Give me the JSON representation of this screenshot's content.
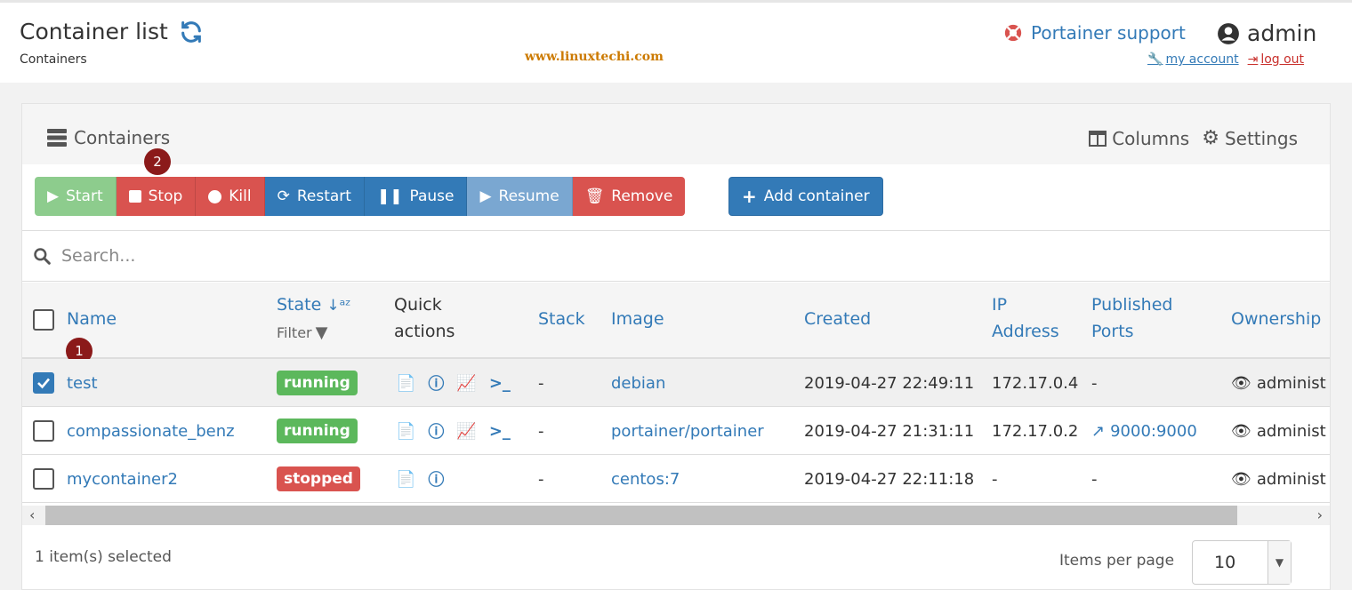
{
  "header": {
    "title": "Container list",
    "breadcrumb": "Containers",
    "watermark": "www.linuxtechi.com",
    "support_link": "Portainer support",
    "user": "admin",
    "my_account": "my account",
    "log_out": "log out"
  },
  "panel": {
    "title": "Containers",
    "columns_label": "Columns",
    "settings_label": "Settings"
  },
  "actions": {
    "start": "Start",
    "stop": "Stop",
    "kill": "Kill",
    "restart": "Restart",
    "pause": "Pause",
    "resume": "Resume",
    "remove": "Remove",
    "add_container": "Add container"
  },
  "markers": {
    "one": "1",
    "two": "2"
  },
  "search": {
    "placeholder": "Search..."
  },
  "columns": {
    "name": "Name",
    "state": "State",
    "filter": "Filter",
    "quick_actions_1": "Quick",
    "quick_actions_2": "actions",
    "stack": "Stack",
    "image": "Image",
    "created": "Created",
    "ip_1": "IP",
    "ip_2": "Address",
    "ports_1": "Published",
    "ports_2": "Ports",
    "ownership": "Ownership"
  },
  "rows": [
    {
      "name": "test",
      "state": "running",
      "stack": "-",
      "image": "debian",
      "created": "2019-04-27 22:49:11",
      "ip": "172.17.0.4",
      "ports": "-",
      "ownership": "administ",
      "selected": true
    },
    {
      "name": "compassionate_benz",
      "state": "running",
      "stack": "-",
      "image": "portainer/portainer",
      "created": "2019-04-27 21:31:11",
      "ip": "172.17.0.2",
      "ports": "9000:9000",
      "ownership": "administ",
      "selected": false
    },
    {
      "name": "mycontainer2",
      "state": "stopped",
      "stack": "-",
      "image": "centos:7",
      "created": "2019-04-27 22:11:18",
      "ip": "-",
      "ports": "-",
      "ownership": "administ",
      "selected": false
    }
  ],
  "footer": {
    "selected_text": "1 item(s) selected",
    "items_per_page_label": "Items per page",
    "items_per_page_value": "10"
  },
  "colors": {
    "primary": "#337ab7",
    "success": "#5cb85c",
    "danger": "#d9534f",
    "marker": "#8b1a1a"
  }
}
